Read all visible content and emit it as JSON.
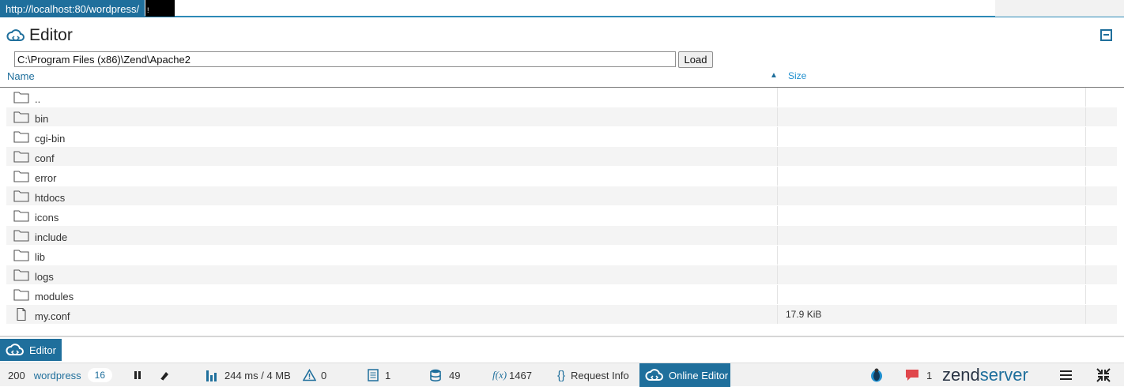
{
  "topbar": {
    "url": "http://localhost:80/wordpress/",
    "overlay_glyph": "!"
  },
  "panel": {
    "title": "Editor"
  },
  "path_bar": {
    "value": "C:\\Program Files (x86)\\Zend\\Apache2",
    "load_label": "Load"
  },
  "columns": {
    "name": "Name",
    "size": "Size",
    "sort_indicator": "▲"
  },
  "files": [
    {
      "name": "..",
      "type": "folder",
      "size": ""
    },
    {
      "name": "bin",
      "type": "folder",
      "size": ""
    },
    {
      "name": "cgi-bin",
      "type": "folder",
      "size": ""
    },
    {
      "name": "conf",
      "type": "folder",
      "size": ""
    },
    {
      "name": "error",
      "type": "folder",
      "size": ""
    },
    {
      "name": "htdocs",
      "type": "folder",
      "size": ""
    },
    {
      "name": "icons",
      "type": "folder",
      "size": ""
    },
    {
      "name": "include",
      "type": "folder",
      "size": ""
    },
    {
      "name": "lib",
      "type": "folder",
      "size": ""
    },
    {
      "name": "logs",
      "type": "folder",
      "size": ""
    },
    {
      "name": "modules",
      "type": "folder",
      "size": ""
    },
    {
      "name": "my.conf",
      "type": "file",
      "size": "17.9 KiB"
    }
  ],
  "editor_tab": {
    "label": "Editor"
  },
  "statusbar": {
    "status_code": "200",
    "app_name": "wordpress",
    "app_badge": "16",
    "timing": "244 ms / 4 MB",
    "events": "0",
    "logs": "1",
    "queries": "49",
    "functions_label": "f(x)",
    "functions": "1467",
    "request_info": "Request Info",
    "online_editor": "Online Editor",
    "notifications": "1",
    "brand_left": "zend",
    "brand_right": "server"
  },
  "colors": {
    "accent": "#1f6f9c",
    "row_alt": "#f4f4f4",
    "statusbar": "#f1f1f1"
  }
}
